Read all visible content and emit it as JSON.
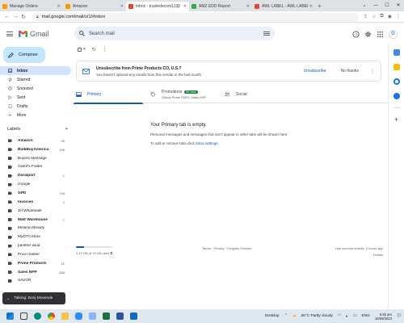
{
  "browser": {
    "tabs": [
      {
        "label": "Manage Orders",
        "color": "#ff9900"
      },
      {
        "label": "Amazon",
        "color": "#ff9900"
      },
      {
        "label": "Inbox - trustedecom12@",
        "color": "#ea4335",
        "active": true
      },
      {
        "label": "AMZ EDD Report",
        "color": "#34a853"
      },
      {
        "label": "AWL LABEL - AWL LABEL",
        "color": "#ea4335"
      }
    ],
    "new_tab": "+",
    "url": "mail.google.com/mail/u/1/#inbox"
  },
  "header": {
    "app_name": "Gmail",
    "search_placeholder": "Search mail",
    "account_initial": "G"
  },
  "sidebar": {
    "compose_label": "Compose",
    "nav": [
      {
        "label": "Inbox",
        "active": true
      },
      {
        "label": "Starred"
      },
      {
        "label": "Snoozed"
      },
      {
        "label": "Sent"
      },
      {
        "label": "Drafts"
      },
      {
        "label": "More"
      }
    ],
    "labels_title": "Labels",
    "labels_add": "+",
    "labels": [
      {
        "name": "Amazon",
        "count": "96",
        "bold": true
      },
      {
        "name": "BulkBuyAmerica",
        "count": "196",
        "bold": true
      },
      {
        "name": "Buyers Message",
        "count": ""
      },
      {
        "name": "Client's Folder",
        "count": ""
      },
      {
        "name": "Doralport",
        "count": "1",
        "bold": true
      },
      {
        "name": "Google",
        "count": ""
      },
      {
        "name": "GPD",
        "count": "706",
        "bold": true
      },
      {
        "name": "Invoices",
        "count": "2",
        "bold": true
      },
      {
        "name": "JH Wholesale",
        "count": ""
      },
      {
        "name": "Matt Warehouse",
        "count": "1",
        "bold": true
      },
      {
        "name": "Melanin Beauty",
        "count": ""
      },
      {
        "name": "MyOTCStore",
        "count": ""
      },
      {
        "name": "panther wind",
        "count": ""
      },
      {
        "name": "Price master",
        "count": ""
      },
      {
        "name": "Prime Products",
        "count": "12",
        "bold": true
      },
      {
        "name": "Sales NPP",
        "count": "658",
        "bold": true
      },
      {
        "name": "SAVOR",
        "count": ""
      }
    ]
  },
  "toolbar": {
    "more": "⋮",
    "refresh": "↻"
  },
  "promo": {
    "title": "Unsubscribe from Prime Products CO, U.S.?",
    "subtitle": "You haven't opened any emails from this sender in the last month",
    "unsubscribe": "Unsubscribe",
    "no_thanks": "No thanks"
  },
  "tabs": {
    "primary": "Primary",
    "promotions": "Promotions",
    "promotions_badge": "50 new",
    "promotions_sub": "Global Prime EMS1 Sales IMP...",
    "social": "Social"
  },
  "empty_state": {
    "heading": "Your Primary tab is empty.",
    "line1": "Personal messages and messages that don't appear in other tabs will be shown here.",
    "line2_prefix": "To add or remove tabs click ",
    "line2_link": "inbox settings",
    "line2_suffix": "."
  },
  "footer": {
    "storage_text": "3.47 GB of 15 GB used",
    "storage_fraction": 0.23,
    "links": "Terms · Privacy · Program Policies",
    "last_activity": "Last account activity: 6 hours ago",
    "details": "Details"
  },
  "snackbar": {
    "text": "Talking: Bonj Movende"
  },
  "taskbar": {
    "desktop": "Desktop",
    "weather": "26°C  Partly cloudy",
    "lang": "ENG",
    "time": "5:30 am",
    "date": "16/09/2023"
  },
  "colors": {
    "accent": "#0b57d0",
    "compose_bg": "#c2e7ff",
    "active_nav": "#d3e3fd",
    "badge_green": "#188038"
  }
}
